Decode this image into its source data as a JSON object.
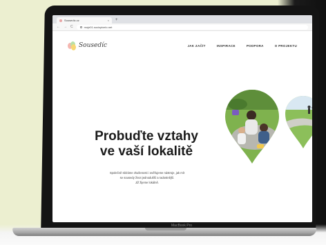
{
  "browser": {
    "tab_title": "Sousedíc.cz",
    "tab_close": "×",
    "new_tab": "+",
    "back": "←",
    "forward": "→",
    "reload": "C",
    "url": "moje01.sociopixelo.net"
  },
  "site": {
    "logo_text": "Sousedíc",
    "nav": [
      "JAK ZAČÍT",
      "INSPIRACE",
      "PODPORA",
      "O PROJEKTU"
    ]
  },
  "hero": {
    "title_line1": "Probuďte vztahy",
    "title_line2": "ve vaší lokalitě",
    "text_line1": "Společně sbíráme zkušenosti i ověřujeme nástroje, jak mít",
    "text_line2": "se sousedy život jednodušší a radostnější.",
    "text_line3": "Již žijeme lokálně."
  },
  "device": {
    "label": "MacBook Pro"
  },
  "colors": {
    "background": "#ecefd0",
    "grass": "#8cbf5a",
    "accent_pink": "#f5b7b1"
  }
}
